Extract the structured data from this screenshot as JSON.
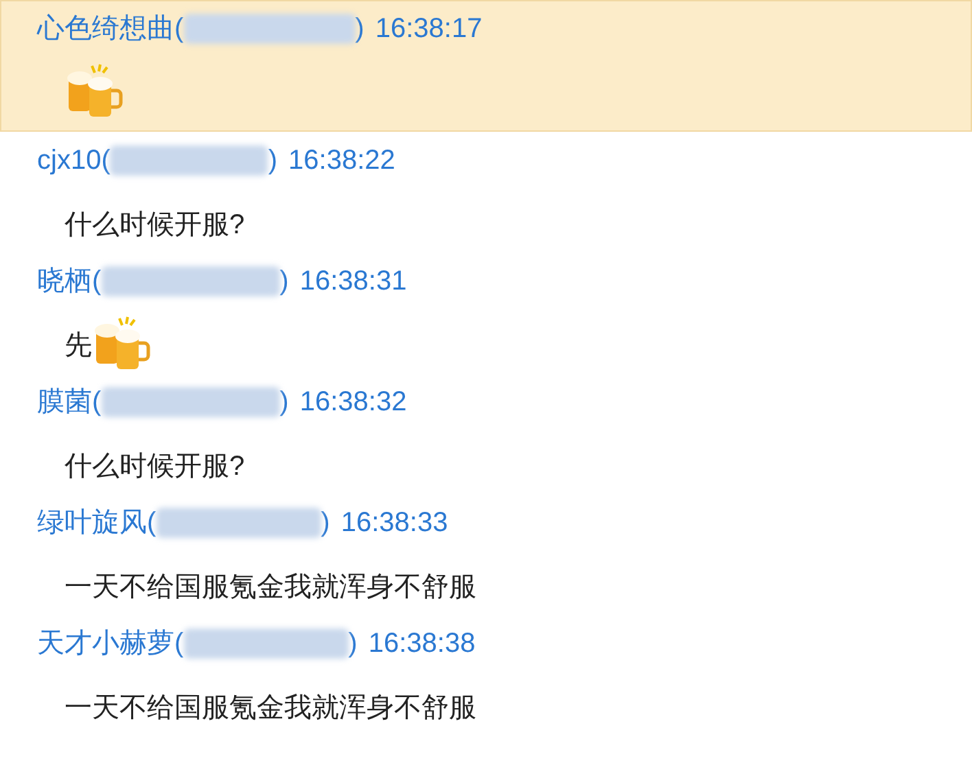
{
  "messages": [
    {
      "sender": "心色绮想曲",
      "open": "(",
      "close": ")",
      "time": "16:38:17",
      "selected": true,
      "content": [
        {
          "kind": "emoji"
        }
      ]
    },
    {
      "sender": "cjx10",
      "open": "(",
      "close": ")",
      "time": "16:38:22",
      "selected": false,
      "content": [
        {
          "kind": "text",
          "text": "什么时候开服?"
        }
      ]
    },
    {
      "sender": "晓栖",
      "open": "(",
      "close": ")",
      "time": "16:38:31",
      "selected": false,
      "content": [
        {
          "kind": "text",
          "text": "先"
        },
        {
          "kind": "emoji"
        }
      ]
    },
    {
      "sender": "膜菌",
      "open": "(",
      "close": ")",
      "time": "16:38:32",
      "selected": false,
      "content": [
        {
          "kind": "text",
          "text": "什么时候开服?"
        }
      ]
    },
    {
      "sender": "绿叶旋风",
      "open": "(",
      "close": ")",
      "time": "16:38:33",
      "selected": false,
      "content": [
        {
          "kind": "text",
          "text": "一天不给国服氪金我就浑身不舒服"
        }
      ]
    },
    {
      "sender": "天才小赫萝",
      "open": "(",
      "close": ")",
      "time": "16:38:38",
      "selected": false,
      "content": [
        {
          "kind": "text",
          "text": "一天不给国服氪金我就浑身不舒服"
        }
      ]
    }
  ]
}
